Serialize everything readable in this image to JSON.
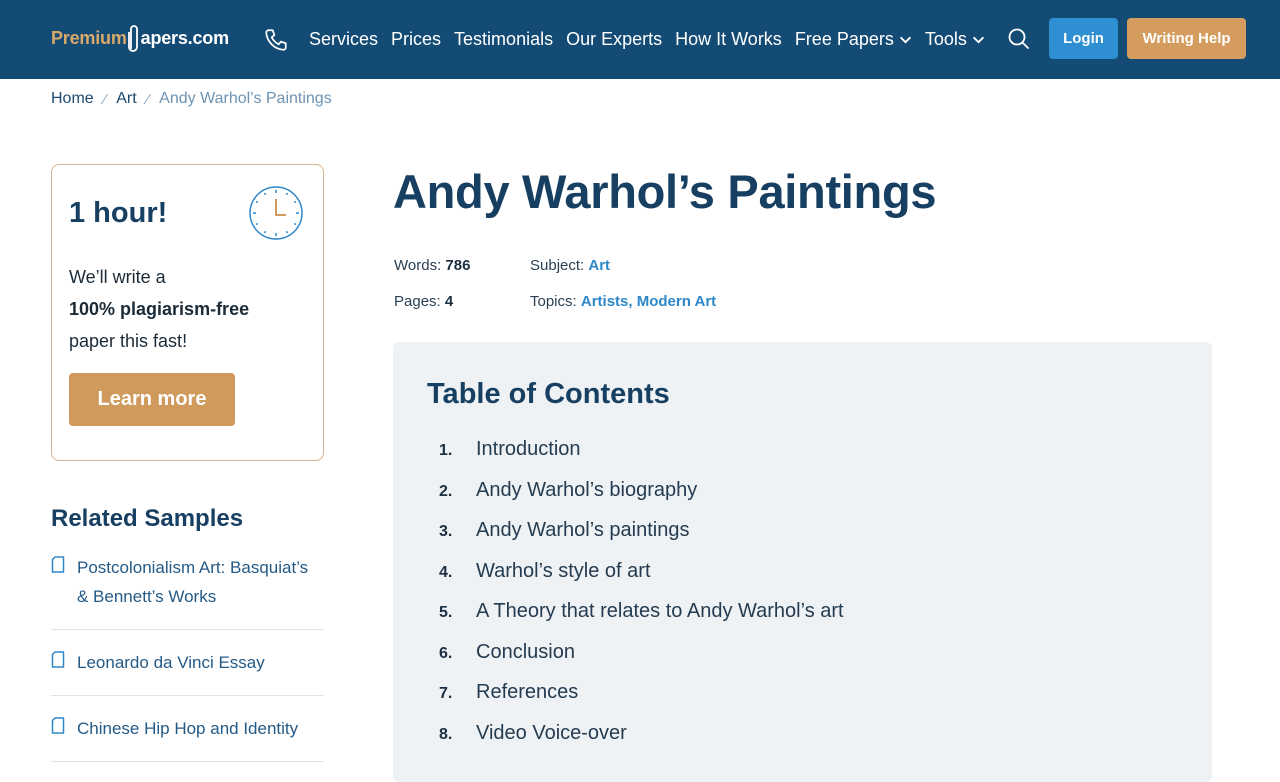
{
  "header": {
    "logo_part1": "Premium",
    "logo_part2": "apers.com",
    "nav": [
      "Services",
      "Prices",
      "Testimonials",
      "Our Experts",
      "How It Works",
      "Free Papers",
      "Tools"
    ],
    "login_label": "Login",
    "writing_help_label": "Writing Help",
    "colors": {
      "background": "#144b74",
      "login": "#2e8fd2",
      "writing_help": "#d49d5f"
    }
  },
  "breadcrumb": {
    "home": "Home",
    "category": "Art",
    "current": "Andy Warhol’s Paintings"
  },
  "promo": {
    "title": "1 hour!",
    "line1": "We’ll write a",
    "line2": "100% plagiarism-free",
    "line3": "paper this fast!",
    "button": "Learn more"
  },
  "related": {
    "title": "Related Samples",
    "items": [
      "Postcolonialism Art: Basquiat’s & Bennett’s Works",
      "Leonardo da Vinci Essay",
      "Chinese Hip Hop and Identity"
    ]
  },
  "article": {
    "title": "Andy Warhol’s Paintings",
    "words_label": "Words:",
    "words": "786",
    "pages_label": "Pages:",
    "pages": "4",
    "subject_label": "Subject:",
    "subject": "Art",
    "topics_label": "Topics:",
    "topic1": "Artists",
    "topic2": "Modern Art"
  },
  "toc": {
    "title": "Table of Contents",
    "items": [
      {
        "num": "1.",
        "label": "Introduction"
      },
      {
        "num": "2.",
        "label": "Andy Warhol’s biography"
      },
      {
        "num": "3.",
        "label": "Andy Warhol’s paintings"
      },
      {
        "num": "4.",
        "label": "Warhol’s style of art"
      },
      {
        "num": "5.",
        "label": "A Theory that relates to Andy Warhol’s art"
      },
      {
        "num": "6.",
        "label": "Conclusion"
      },
      {
        "num": "7.",
        "label": "References"
      },
      {
        "num": "8.",
        "label": "Video Voice-over"
      }
    ]
  }
}
